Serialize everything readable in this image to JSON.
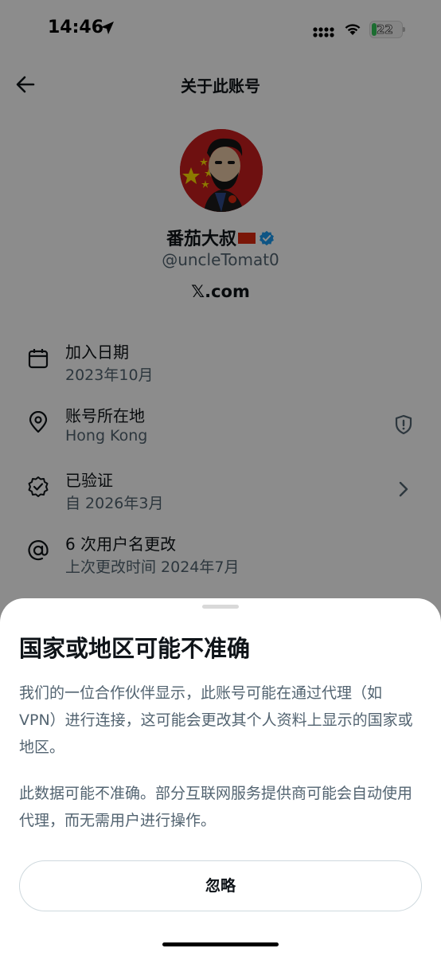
{
  "status_bar": {
    "time": "14:46",
    "battery": "22"
  },
  "header": {
    "title": "关于此账号"
  },
  "profile": {
    "name": "番茄大叔",
    "handle": "@uncleTomat0",
    "site": "𝕏.com"
  },
  "info": [
    {
      "label": "加入日期",
      "value": "2023年10月",
      "icon": "calendar-icon"
    },
    {
      "label": "账号所在地",
      "value": "Hong Kong",
      "icon": "location-pin-icon"
    },
    {
      "label": "已验证",
      "value": "自 2026年3月",
      "icon": "verified-badge-icon"
    },
    {
      "label": "6 次用户名更改",
      "value": "上次更改时间 2024年7月",
      "icon": "at-sign-icon"
    }
  ],
  "sheet": {
    "title": "国家或地区可能不准确",
    "paragraph1": "我们的一位合作伙伴显示，此账号可能在通过代理（如 VPN）进行连接，这可能会更改其个人资料上显示的国家或地区。",
    "paragraph2": "此数据可能不准确。部分互联网服务提供商可能会自动使用代理，而无需用户进行操作。",
    "button": "忽略"
  },
  "colors": {
    "accent": "#1d9bf0",
    "text": "#0f1419",
    "secondary": "#536471"
  }
}
